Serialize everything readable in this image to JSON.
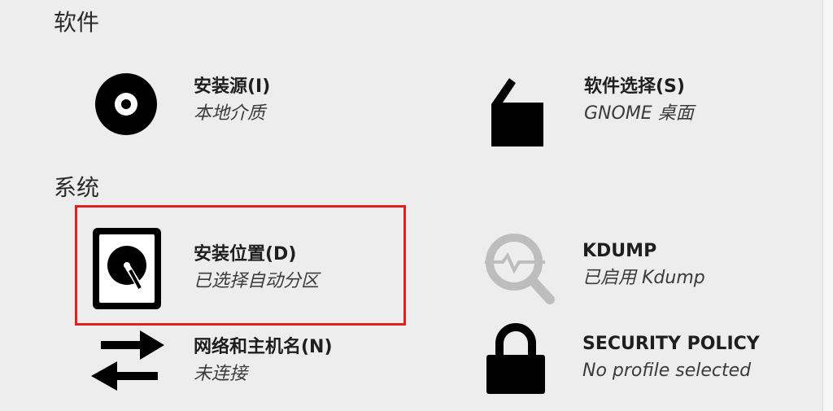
{
  "sections": {
    "software_title": "软件",
    "system_title": "系统"
  },
  "spokes": {
    "install_source": {
      "title": "安装源(I)",
      "status": "本地介质",
      "icon": "disc-icon"
    },
    "software_selection": {
      "title": "软件选择(S)",
      "status": "GNOME 桌面",
      "icon": "package-icon"
    },
    "install_destination": {
      "title": "安装位置(D)",
      "status": "已选择自动分区",
      "icon": "harddisk-icon"
    },
    "kdump": {
      "title": "KDUMP",
      "status": "已启用 Kdump",
      "icon": "kdump-search-icon"
    },
    "network_hostname": {
      "title": "网络和主机名(N)",
      "status": "未连接",
      "icon": "network-arrows-icon"
    },
    "security_policy": {
      "title": "SECURITY POLICY",
      "status": "No profile selected",
      "icon": "lock-icon"
    }
  },
  "colors": {
    "background": "#ededed",
    "highlight": "#e02020",
    "icon": "#000000",
    "kdump_icon": "#bdbdbd"
  }
}
